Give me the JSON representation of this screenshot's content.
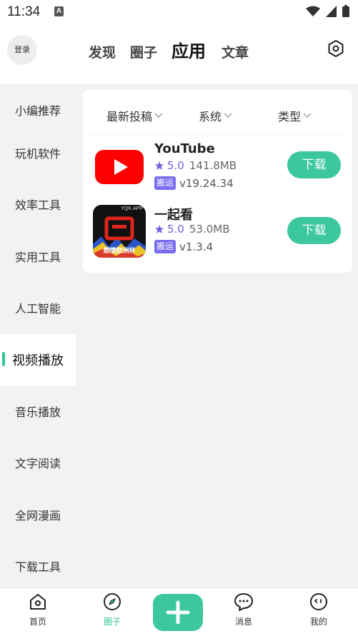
{
  "status_bar": {
    "time": "11:34",
    "notification_letter": "A",
    "icons": [
      "wifi-icon",
      "cellular-signal-icon",
      "battery-icon"
    ]
  },
  "header": {
    "login_label": "登录",
    "tabs": [
      {
        "label": "发现",
        "active": false
      },
      {
        "label": "圈子",
        "active": false
      },
      {
        "label": "应用",
        "active": true
      },
      {
        "label": "文章",
        "active": false
      }
    ],
    "settings_icon": "settings-hexagon-icon"
  },
  "sidebar": {
    "items": [
      {
        "label": "小编推荐",
        "active": false
      },
      {
        "label": "玩机软件",
        "active": false
      },
      {
        "label": "效率工具",
        "active": false
      },
      {
        "label": "实用工具",
        "active": false
      },
      {
        "label": "人工智能",
        "active": false
      },
      {
        "label": "视频播放",
        "active": true
      },
      {
        "label": "音乐播放",
        "active": false
      },
      {
        "label": "文字阅读",
        "active": false
      },
      {
        "label": "全网漫画",
        "active": false
      },
      {
        "label": "下载工具",
        "active": false
      }
    ]
  },
  "filters": [
    {
      "label": "最新投稿"
    },
    {
      "label": "系统"
    },
    {
      "label": "类型"
    }
  ],
  "apps": [
    {
      "name": "YouTube",
      "rating": "5.0",
      "size": "141.8MB",
      "badge": "搬运",
      "version": "v19.24.34",
      "action": "下载",
      "icon": "youtube-logo-icon"
    },
    {
      "name": "一起看",
      "rating": "5.0",
      "size": "53.0MB",
      "badge": "搬运",
      "version": "v1.3.4",
      "action": "下载",
      "icon": "yiqikan-app-icon",
      "icon_text_top": "YQK.APP",
      "icon_text_bottom": "燃情欧洲杯"
    }
  ],
  "bottom_nav": {
    "items": [
      {
        "label": "首页",
        "icon": "home-icon",
        "active": false
      },
      {
        "label": "圈子",
        "icon": "compass-icon",
        "active": true
      },
      {
        "label": "",
        "icon": "plus-icon",
        "active": false
      },
      {
        "label": "消息",
        "icon": "chat-bubble-icon",
        "active": false
      },
      {
        "label": "我的",
        "icon": "face-icon",
        "active": false
      }
    ]
  },
  "colors": {
    "accent": "#3cc79e",
    "rating": "#6f63e0",
    "badge": "#7a6cf0",
    "background": "#f2f2f2"
  }
}
